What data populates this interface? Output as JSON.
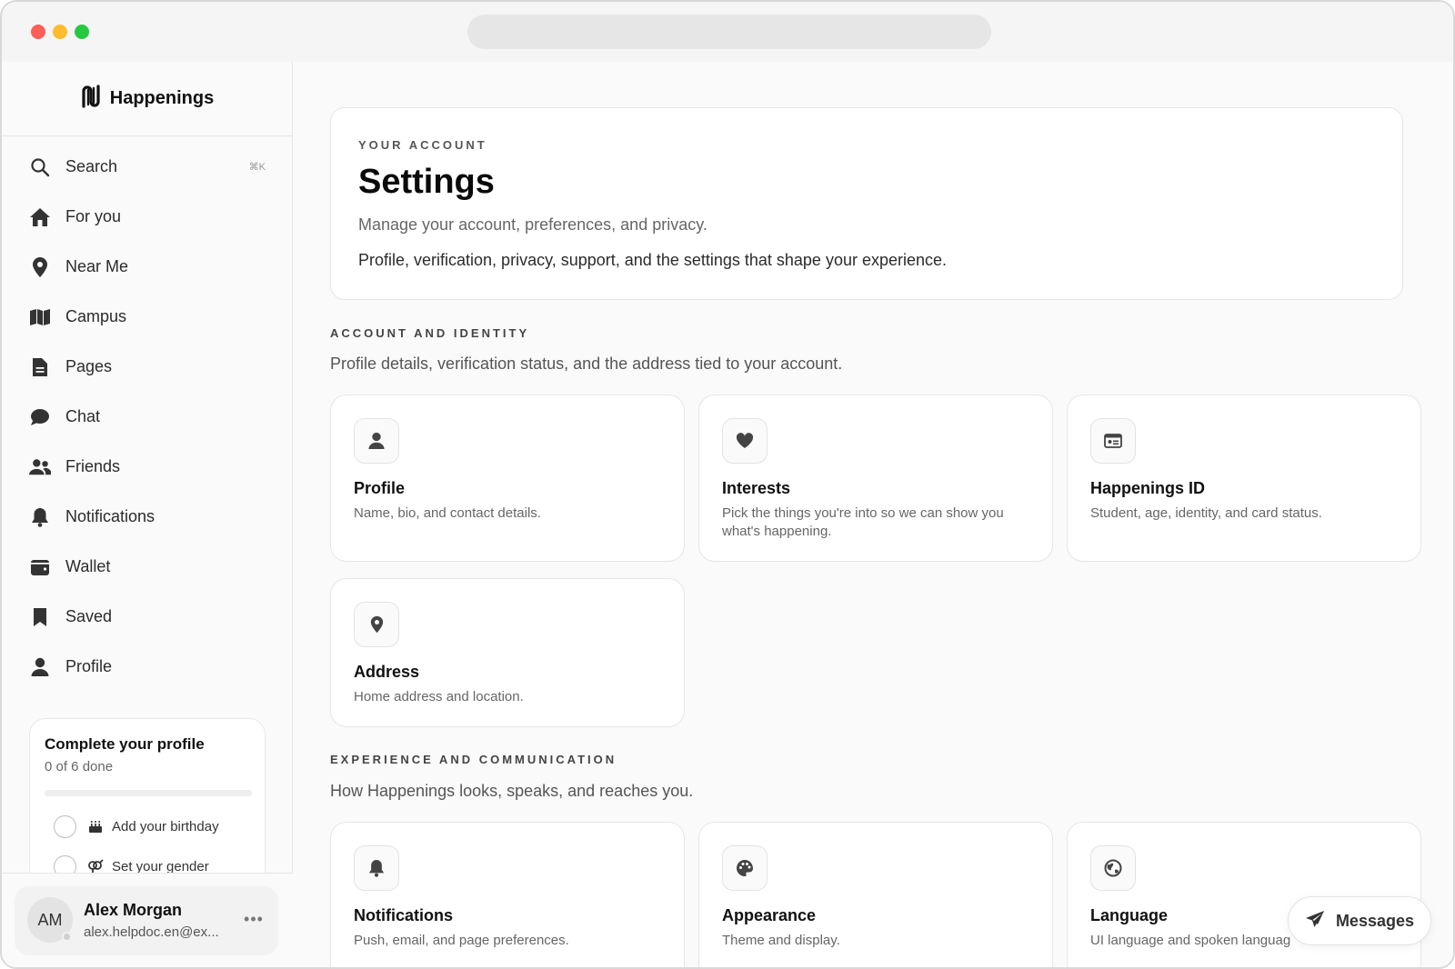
{
  "app": {
    "name": "Happenings"
  },
  "sidebar": {
    "items": [
      {
        "id": "search",
        "label": "Search",
        "icon": "search-icon",
        "shortcut": "⌘K"
      },
      {
        "id": "for-you",
        "label": "For you",
        "icon": "home-icon"
      },
      {
        "id": "near-me",
        "label": "Near Me",
        "icon": "map-pin-icon"
      },
      {
        "id": "campus",
        "label": "Campus",
        "icon": "map-icon"
      },
      {
        "id": "pages",
        "label": "Pages",
        "icon": "document-icon"
      },
      {
        "id": "chat",
        "label": "Chat",
        "icon": "chat-bubble-icon"
      },
      {
        "id": "friends",
        "label": "Friends",
        "icon": "users-icon"
      },
      {
        "id": "notifications",
        "label": "Notifications",
        "icon": "bell-icon"
      },
      {
        "id": "wallet",
        "label": "Wallet",
        "icon": "wallet-icon"
      },
      {
        "id": "saved",
        "label": "Saved",
        "icon": "bookmark-icon"
      },
      {
        "id": "profile",
        "label": "Profile",
        "icon": "user-icon"
      }
    ],
    "profile_card": {
      "title": "Complete your profile",
      "progress_text": "0 of 6 done",
      "progress_fraction": 0,
      "tasks": [
        {
          "label": "Add your birthday",
          "icon": "birthday-cake-icon"
        },
        {
          "label": "Set your gender",
          "icon": "gender-icon"
        }
      ]
    },
    "user": {
      "initials": "AM",
      "name": "Alex Morgan",
      "email": "alex.helpdoc.en@ex..."
    }
  },
  "main": {
    "hero": {
      "eyebrow": "YOUR ACCOUNT",
      "title": "Settings",
      "subtitle": "Manage your account, preferences, and privacy.",
      "description": "Profile, verification, privacy, support, and the settings that shape your experience."
    },
    "sections": [
      {
        "title": "ACCOUNT AND IDENTITY",
        "description": "Profile details, verification status, and the address tied to your account.",
        "cards": [
          {
            "title": "Profile",
            "description": "Name, bio, and contact details.",
            "icon": "user-icon"
          },
          {
            "title": "Interests",
            "description": "Pick the things you're into so we can show you what's happening.",
            "icon": "heart-icon"
          },
          {
            "title": "Happenings ID",
            "description": "Student, age, identity, and card status.",
            "icon": "id-card-icon"
          },
          {
            "title": "Address",
            "description": "Home address and location.",
            "icon": "map-pin-icon"
          }
        ]
      },
      {
        "title": "EXPERIENCE AND COMMUNICATION",
        "description": "How Happenings looks, speaks, and reaches you.",
        "cards": [
          {
            "title": "Notifications",
            "description": "Push, email, and page preferences.",
            "icon": "bell-icon"
          },
          {
            "title": "Appearance",
            "description": "Theme and display.",
            "icon": "palette-icon"
          },
          {
            "title": "Language",
            "description": "UI language and spoken languag",
            "icon": "globe-icon"
          }
        ]
      }
    ],
    "messages_button": {
      "label": "Messages",
      "icon": "paper-plane-icon"
    }
  },
  "colors": {
    "accent": "#111111",
    "traffic_red": "#ff5f57",
    "traffic_yellow": "#febc2e",
    "traffic_green": "#28c840"
  }
}
